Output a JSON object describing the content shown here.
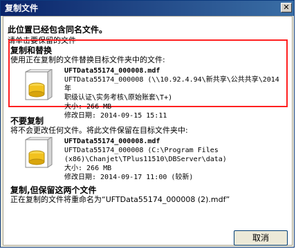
{
  "window": {
    "title": "复制文件",
    "close_label": "✕"
  },
  "intro": {
    "heading": "此位置已经包含同名文件。",
    "subheading": "请单击要保留的文件"
  },
  "options": [
    {
      "title": "复制和替换",
      "description": "使用正在复制的文件替换目标文件夹中的文件:",
      "file_name": "UFTData55174_000008.mdf",
      "path_line1": "UFTData55174_000008 (\\\\10.92.4.94\\新共享\\公共共享\\2014年",
      "path_line2": "职级认证\\实务考核\\原始账套\\T+)",
      "size": "大小: 266 MB",
      "modified": "修改日期: 2014-09-15 15:11"
    },
    {
      "title": "不要复制",
      "description": "将不会更改任何文件。将此文件保留在目标文件夹中:",
      "file_name": "UFTData55174_000008.mdf",
      "path_line1": "UFTData55174_000008 (C:\\Program Files",
      "path_line2": "(x86)\\Chanjet\\TPlus11510\\DBServer\\data)",
      "size": "大小: 266 MB",
      "modified": "修改日期: 2014-09-17 11:00 (较新)"
    },
    {
      "title": "复制,但保留这两个文件",
      "description": "正在复制的文件将重命名为“UFTData55174_000008 (2).mdf”"
    }
  ],
  "buttons": {
    "cancel": "取消"
  },
  "colors": {
    "titlebar_start": "#0a246a",
    "titlebar_end": "#3a6ea5",
    "highlight": "#ff1f1f"
  }
}
